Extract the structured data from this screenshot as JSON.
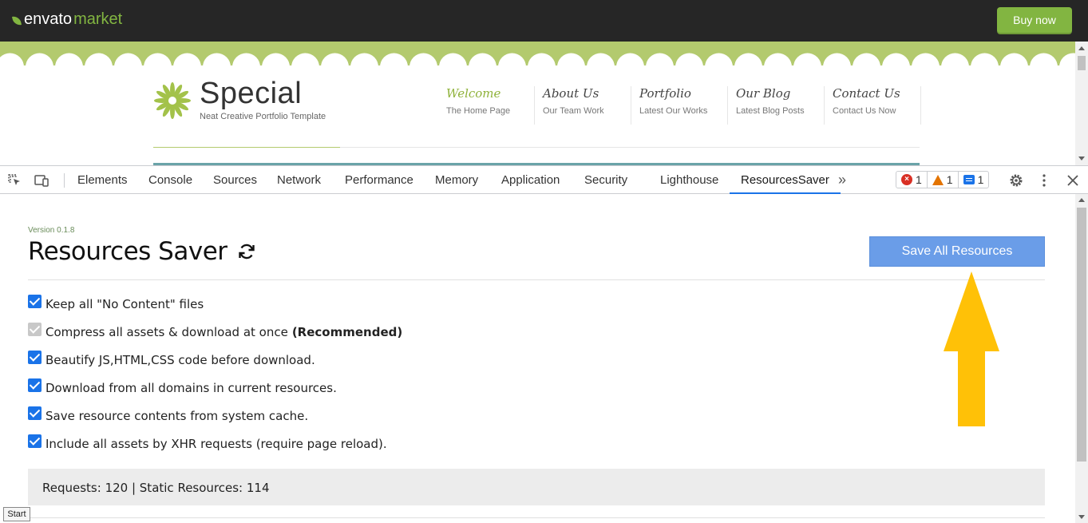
{
  "envato": {
    "logo_brand": "envato",
    "logo_market": "market",
    "buy_now": "Buy now",
    "accent": "#82b541"
  },
  "site": {
    "brand_title": "Special",
    "brand_subtitle": "Neat Creative Portfolio Template",
    "nav": [
      {
        "title": "Welcome",
        "sub": "The Home Page",
        "active": true
      },
      {
        "title": "About Us",
        "sub": "Our Team Work",
        "active": false
      },
      {
        "title": "Portfolio",
        "sub": "Latest Our Works",
        "active": false
      },
      {
        "title": "Our Blog",
        "sub": "Latest Blog Posts",
        "active": false
      },
      {
        "title": "Contact Us",
        "sub": "Contact Us Now",
        "active": false
      }
    ]
  },
  "devtools": {
    "tabs": [
      "Elements",
      "Console",
      "Sources",
      "Network",
      "Performance",
      "Memory",
      "Application",
      "Security",
      "Lighthouse",
      "ResourcesSaver"
    ],
    "active_tab": "ResourcesSaver",
    "more_tabs": "»",
    "errors": "1",
    "warnings": "1",
    "messages": "1",
    "icons": [
      "inspect-icon",
      "device-toggle-icon",
      "settings-icon",
      "kebab-menu-icon",
      "close-icon"
    ]
  },
  "panel": {
    "version": "Version 0.1.8",
    "title": "Resources Saver",
    "save_button": "Save All Resources",
    "options": [
      {
        "label": "Keep all \"No Content\" files",
        "bold": "",
        "checked": true,
        "disabled": false
      },
      {
        "label": "Compress all assets & download at once",
        "bold": "(Recommended)",
        "checked": true,
        "disabled": true
      },
      {
        "label": "Beautify JS,HTML,CSS code before download.",
        "bold": "",
        "checked": true,
        "disabled": false
      },
      {
        "label": "Download from all domains in current resources.",
        "bold": "",
        "checked": true,
        "disabled": false
      },
      {
        "label": "Save resource contents from system cache.",
        "bold": "",
        "checked": true,
        "disabled": false
      },
      {
        "label": "Include all assets by XHR requests (require page reload).",
        "bold": "",
        "checked": true,
        "disabled": false
      }
    ],
    "stats": "Requests: 120 | Static Resources: 114",
    "annotation_color": "#ffc107"
  },
  "start_label": "Start"
}
